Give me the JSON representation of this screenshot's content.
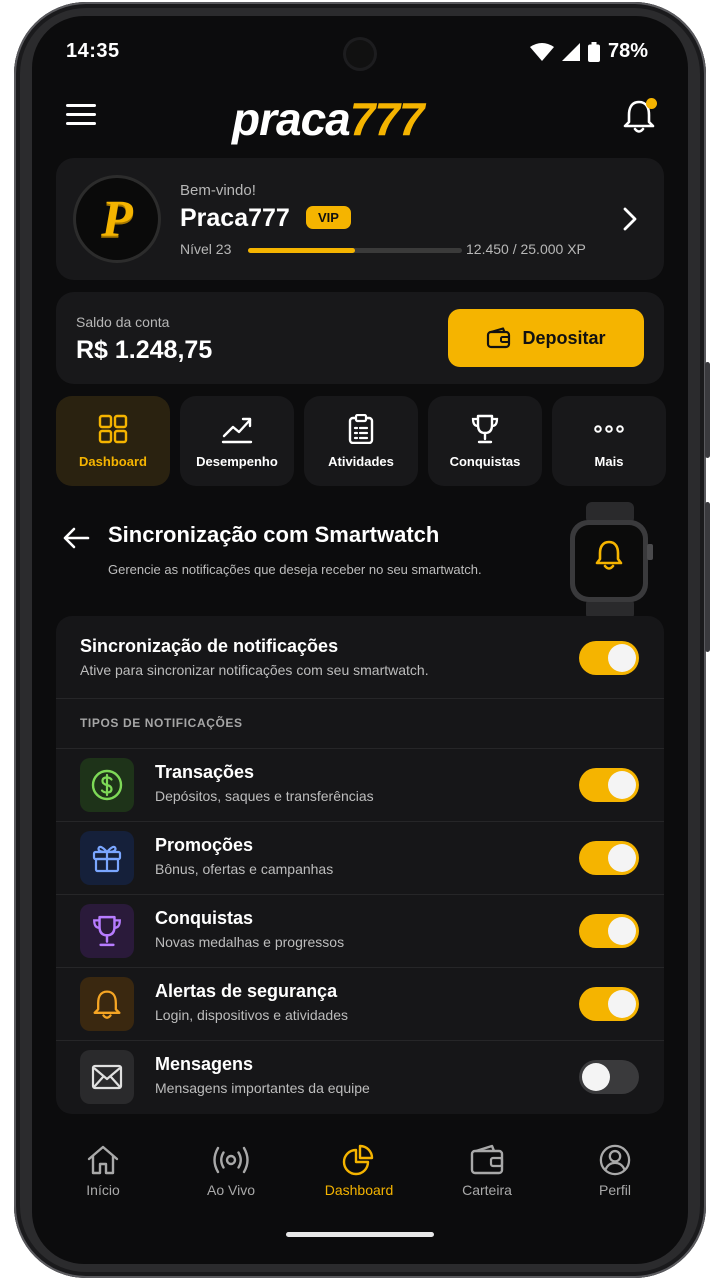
{
  "status_bar": {
    "time": "14:35",
    "battery": "78%"
  },
  "header": {
    "logo_text": "praca",
    "logo_number": "777"
  },
  "profile": {
    "welcome": "Bem-vindo!",
    "avatar_letter": "P",
    "username": "Praca777",
    "badge": "VIP",
    "level": "Nível 23",
    "xp_text": "12.450 / 25.000 XP",
    "xp_progress": 0.498
  },
  "balance": {
    "label": "Saldo da conta",
    "value": "R$ 1.248,75",
    "deposit_label": "Depositar"
  },
  "quick_tabs": [
    {
      "label": "Dashboard",
      "icon": "grid-icon",
      "active": true
    },
    {
      "label": "Desempenho",
      "icon": "trend-chart-icon",
      "active": false
    },
    {
      "label": "Atividades",
      "icon": "clipboard-icon",
      "active": false
    },
    {
      "label": "Conquistas",
      "icon": "trophy-icon",
      "active": false
    },
    {
      "label": "Mais",
      "icon": "more-dots-icon",
      "active": false
    }
  ],
  "section": {
    "title": "Sincronização com Smartwatch",
    "subtitle": "Gerencie as notificações que deseja receber no seu smartwatch."
  },
  "sync": {
    "title": "Sincronização de notificações",
    "subtitle": "Ative para sincronizar notificações com seu smartwatch.",
    "enabled": true
  },
  "types_header": "TIPOS DE NOTIFICAÇÕES",
  "notification_types": [
    {
      "title": "Transações",
      "subtitle": "Depósitos, saques e transferências",
      "icon": "dollar-icon",
      "color": "#7ed957",
      "enabled": true
    },
    {
      "title": "Promoções",
      "subtitle": "Bônus, ofertas e campanhas",
      "icon": "gift-icon",
      "color": "#7aa6ff",
      "enabled": true
    },
    {
      "title": "Conquistas",
      "subtitle": "Novas medalhas e progressos",
      "icon": "trophy-icon",
      "color": "#b77cff",
      "enabled": true
    },
    {
      "title": "Alertas de segurança",
      "subtitle": "Login, dispositivos e atividades",
      "icon": "bell-icon",
      "color": "#f5a524",
      "enabled": true
    },
    {
      "title": "Mensagens",
      "subtitle": "Mensagens importantes da equipe",
      "icon": "mail-icon",
      "color": "#e0e0e0",
      "enabled": false
    }
  ],
  "bottom_nav": [
    {
      "label": "Início",
      "icon": "home-icon",
      "active": false
    },
    {
      "label": "Ao Vivo",
      "icon": "live-icon",
      "active": false
    },
    {
      "label": "Dashboard",
      "icon": "pie-chart-icon",
      "active": true
    },
    {
      "label": "Carteira",
      "icon": "wallet-icon",
      "active": false
    },
    {
      "label": "Perfil",
      "icon": "user-icon",
      "active": false
    }
  ],
  "colors": {
    "accent": "#f5b400",
    "background": "#0c0c0d",
    "card": "#18181a"
  }
}
